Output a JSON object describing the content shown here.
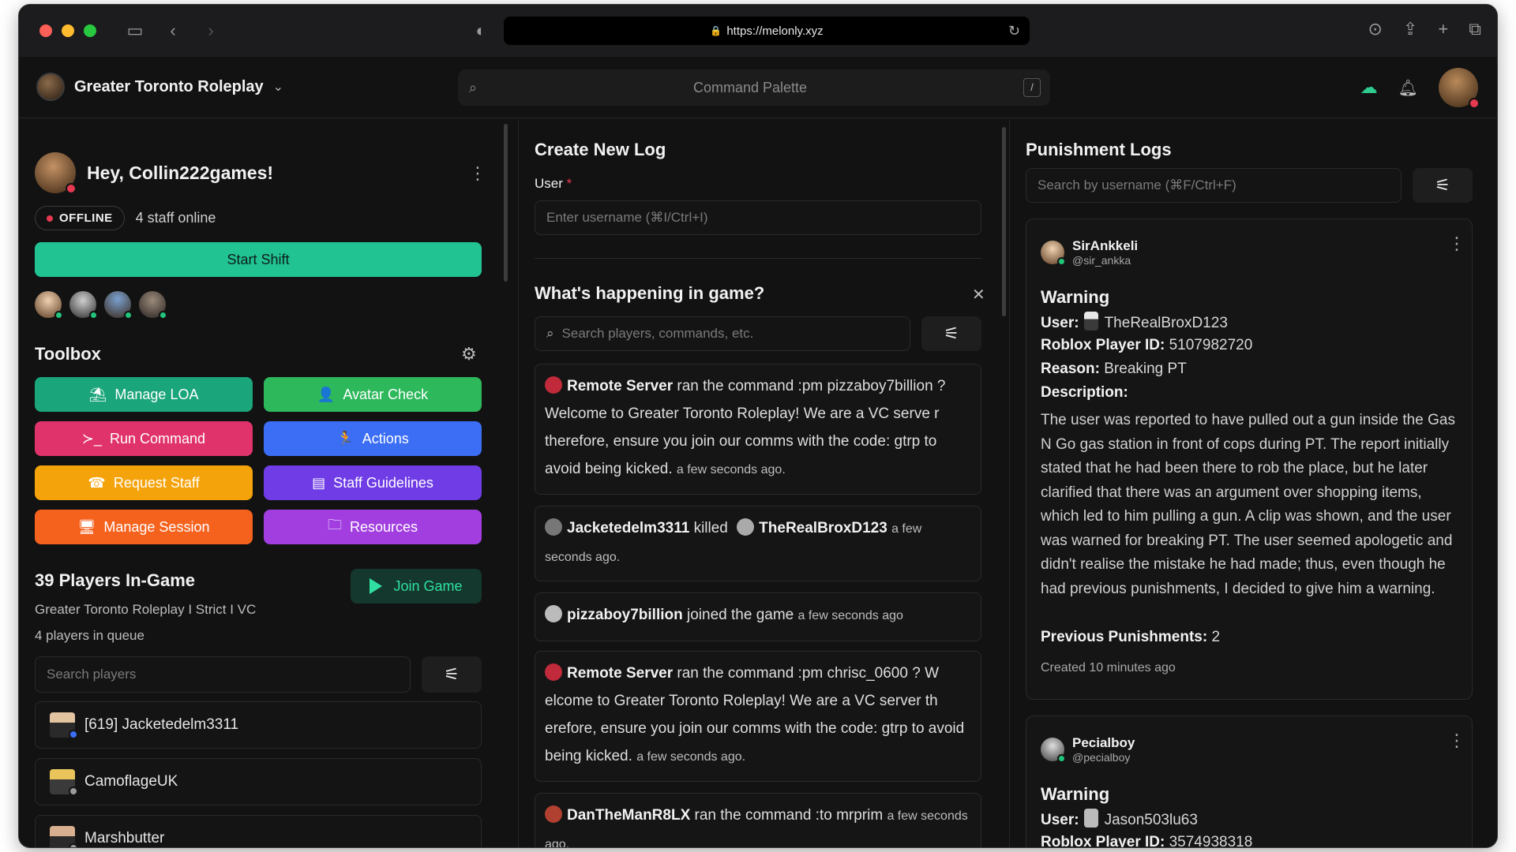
{
  "browser": {
    "url": "https://melonly.xyz"
  },
  "app": {
    "server_name": "Greater Toronto Roleplay",
    "command_palette_placeholder": "Command Palette",
    "command_palette_shortcut": "/"
  },
  "left": {
    "greeting": "Hey, Collin222games!",
    "status": "OFFLINE",
    "staff_online": "4 staff online",
    "start_shift": "Start Shift",
    "toolbox_title": "Toolbox",
    "toolbox": [
      {
        "label": "Manage LOA",
        "color": "#1aa57a",
        "icon": "⛱"
      },
      {
        "label": "Avatar Check",
        "color": "#2eb85c",
        "icon": "👤"
      },
      {
        "label": "Run Command",
        "color": "#e0336b",
        "icon": "≻_"
      },
      {
        "label": "Actions",
        "color": "#3b6ef5",
        "icon": "🏃"
      },
      {
        "label": "Request Staff",
        "color": "#f5a30b",
        "icon": "☎"
      },
      {
        "label": "Staff Guidelines",
        "color": "#6f3ce6",
        "icon": "▤"
      },
      {
        "label": "Manage Session",
        "color": "#f5621e",
        "icon": "🖥"
      },
      {
        "label": "Resources",
        "color": "#a23ee0",
        "icon": "🗀"
      }
    ],
    "players_title": "39 Players In-Game",
    "server_subtitle": "Greater Toronto Roleplay I Strict I VC",
    "queue": "4 players in queue",
    "join_game": "Join Game",
    "search_players_placeholder": "Search players",
    "players": [
      {
        "name": "[619] Jacketedelm3311",
        "badge_color": "#3b6ef5"
      },
      {
        "name": "CamoflageUK",
        "badge_color": "#9a9a9a"
      },
      {
        "name": "Marshbutter",
        "badge_color": "#9a9a9a"
      }
    ]
  },
  "middle": {
    "create_title": "Create New Log",
    "user_label": "User",
    "required_mark": "*",
    "user_placeholder": "Enter username (⌘I/Ctrl+I)",
    "happening_title": "What's happening in game?",
    "feed_search_placeholder": "Search players, commands, etc.",
    "feed": [
      {
        "actor": "Remote Server",
        "text": "ran the command :pm pizzaboy7billion ? Welcome to Greater Toronto Roleplay! We are a VC serve r therefore, ensure you join our comms with the code: gtrp to avoid being kicked.",
        "time": "a few seconds ago."
      },
      {
        "actor": "Jacketedelm3311",
        "verb": "killed",
        "target": "TheRealBroxD123",
        "time": "a few seconds ago."
      },
      {
        "actor": "pizzaboy7billion",
        "text": "joined the game",
        "time": "a few seconds ago"
      },
      {
        "actor": "Remote Server",
        "text": "ran the command :pm chrisc_0600 ? W elcome to Greater Toronto Roleplay! We are a VC server th erefore, ensure you join our comms with the code: gtrp to avoid being kicked.",
        "time": "a few seconds ago."
      },
      {
        "actor": "DanTheManR8LX",
        "text": "ran the command :to mrprim",
        "time": "a few seconds ago."
      }
    ]
  },
  "right": {
    "title": "Punishment Logs",
    "search_placeholder": "Search by username (⌘F/Ctrl+F)",
    "logs": [
      {
        "moderator": "SirAnkkeli",
        "handle": "@sir_ankka",
        "type": "Warning",
        "user_label": "User:",
        "user": "TheRealBroxD123",
        "roblox_label": "Roblox Player ID:",
        "roblox_id": "5107982720",
        "reason_label": "Reason:",
        "reason": "Breaking PT",
        "description_label": "Description:",
        "description": "The user was reported to have pulled out a gun inside the Gas N Go gas station in front of cops during PT. The report initially stated that he had been there to rob the place, but he later clarified that there was an argument over shopping items, which led to him pulling a gun. A clip was shown, and the user was warned for breaking PT. The user seemed apologetic and didn't realise the mistake he had made; thus, even though he had previous punishments, I decided to give him a warning.",
        "prev_label": "Previous Punishments:",
        "prev": "2",
        "created": "Created 10 minutes ago"
      },
      {
        "moderator": "Pecialboy",
        "handle": "@pecialboy",
        "type": "Warning",
        "user_label": "User:",
        "user": "Jason503lu63",
        "roblox_label": "Roblox Player ID:",
        "roblox_id": "3574938318"
      }
    ]
  },
  "colors": {
    "accent_green": "#22c393",
    "status_red": "#e53950",
    "online_green": "#22c37a"
  }
}
